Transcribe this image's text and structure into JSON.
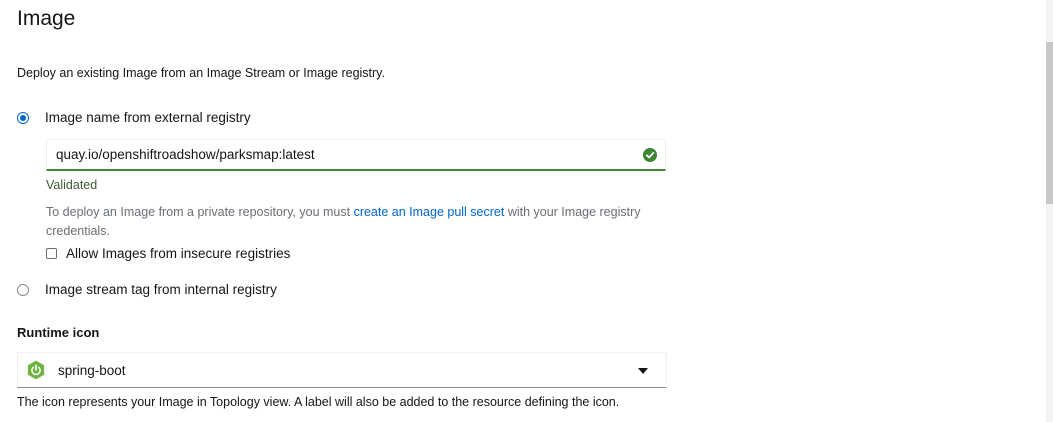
{
  "section": {
    "title": "Image",
    "description": "Deploy an existing Image from an Image Stream or Image registry."
  },
  "radio_external": {
    "label": "Image name from external registry",
    "checked": true
  },
  "image_input": {
    "value": "quay.io/openshiftroadshow/parksmap:latest",
    "status_icon": "check-circle-icon"
  },
  "validation": {
    "text": "Validated"
  },
  "helper": {
    "text_before": "To deploy an Image from a private repository, you must ",
    "link_text": "create an Image pull secret",
    "text_after": " with your Image registry credentials."
  },
  "insecure_checkbox": {
    "label": "Allow Images from insecure registries",
    "checked": false
  },
  "radio_internal": {
    "label": "Image stream tag from internal registry",
    "checked": false
  },
  "runtime_icon": {
    "label": "Runtime icon",
    "selected_value": "spring-boot",
    "selected_icon": "spring-boot-power-icon",
    "help_text": "The icon represents your Image in Topology view. A label will also be added to the resource defining the icon."
  },
  "colors": {
    "primary": "#0066cc",
    "success": "#3e8635",
    "spring": "#6db33f"
  }
}
